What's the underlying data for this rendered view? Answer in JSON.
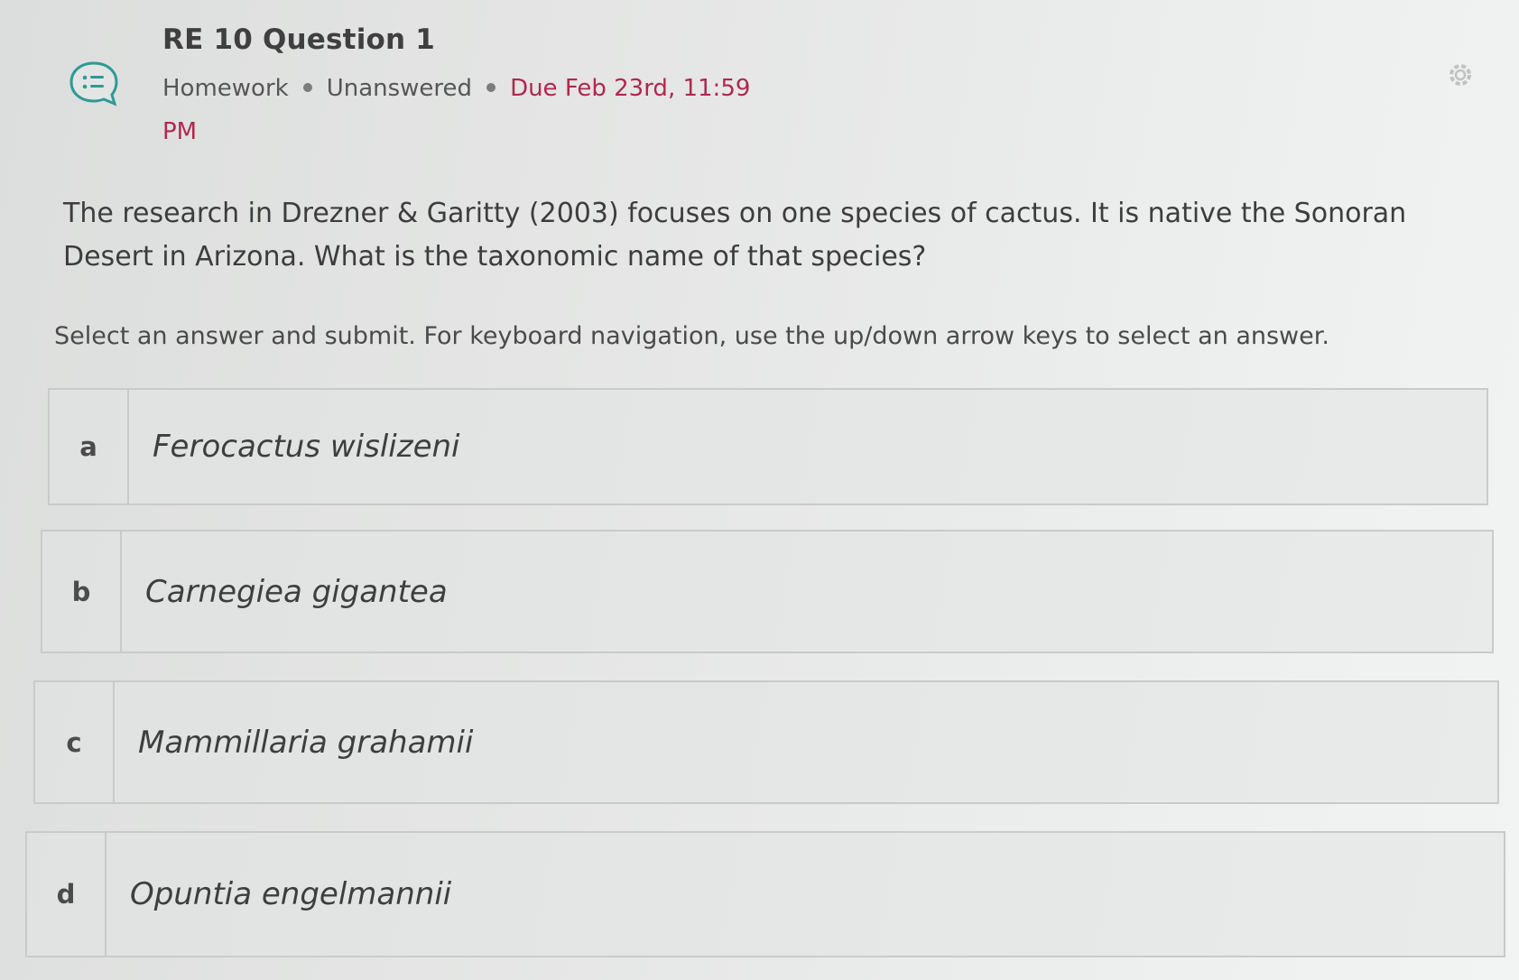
{
  "header": {
    "title": "RE 10 Question 1",
    "type": "Homework",
    "status": "Unanswered",
    "due": "Due Feb 23rd, 11:59",
    "due_suffix": "PM"
  },
  "question": {
    "line1": "The research in Drezner & Garitty (2003) focuses on one species of cactus. It is native the Sonoran",
    "line2": "Desert in Arizona. What is the taxonomic name of that species?"
  },
  "instructions": "Select an answer and submit. For keyboard navigation, use the up/down arrow keys to select an answer.",
  "options": [
    {
      "letter": "a",
      "text": "Ferocactus wislizeni"
    },
    {
      "letter": "b",
      "text": "Carnegiea gigantea"
    },
    {
      "letter": "c",
      "text": "Mammillaria grahamii"
    },
    {
      "letter": "d",
      "text": "Opuntia engelmannii"
    }
  ],
  "icons": {
    "type_icon": "discussion-list-icon",
    "settings_icon": "gear-icon"
  },
  "colors": {
    "due_accent": "#b02850",
    "icon_teal": "#2e9a95"
  }
}
